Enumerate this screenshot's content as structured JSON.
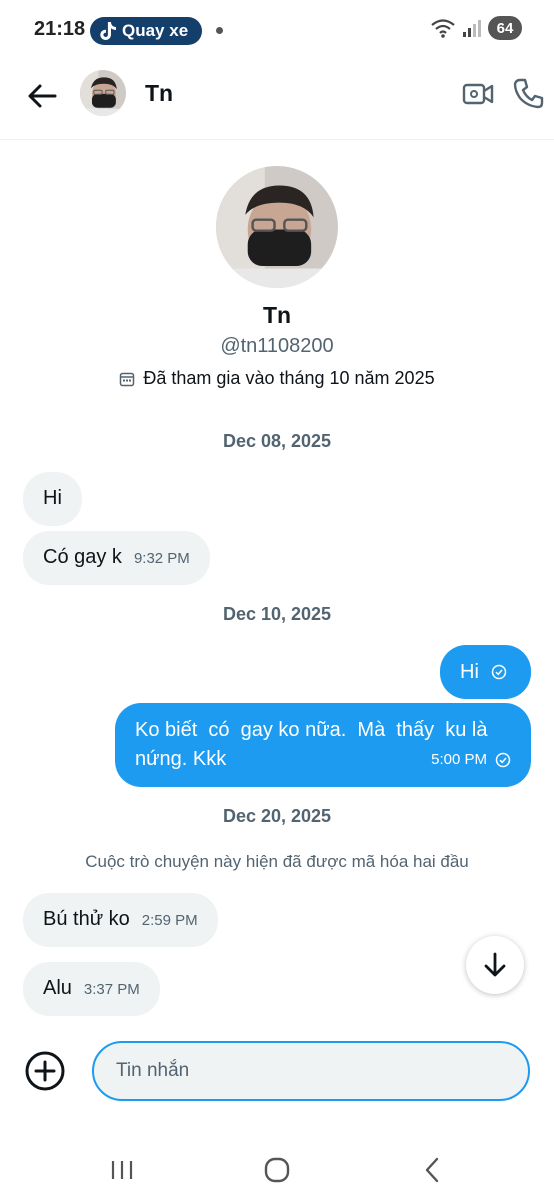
{
  "status_bar": {
    "time": "21:18",
    "pill_label": "Quay xe",
    "battery": "64"
  },
  "header": {
    "name": "Tn"
  },
  "profile": {
    "name": "Tn",
    "handle": "@tn1108200",
    "joined": "Đã tham gia vào tháng 10 năm 2025"
  },
  "conversation": {
    "date_1": "Dec 08, 2025",
    "msg_1": "Hi",
    "msg_2": "Có gay k",
    "msg_2_time": "9:32 PM",
    "date_2": "Dec 10, 2025",
    "msg_3": "Hi",
    "msg_4_line1": "Ko biết  có  gay ko nữa.  Mà  thấy  ku là",
    "msg_4_line2": "nứng. Kkk",
    "msg_4_time": "5:00 PM",
    "date_3": "Dec 20, 2025",
    "encryption_note": "Cuộc trò chuyện này hiện đã được mã hóa hai đầu",
    "msg_5": "Bú thử ko",
    "msg_5_time": "2:59 PM",
    "msg_6": "Alu",
    "msg_6_time": "3:37 PM"
  },
  "composer": {
    "placeholder": "Tin nhắn"
  },
  "colors": {
    "accent": "#1d9bf0",
    "incoming_bubble": "#eff3f4",
    "secondary_text": "#536471"
  }
}
